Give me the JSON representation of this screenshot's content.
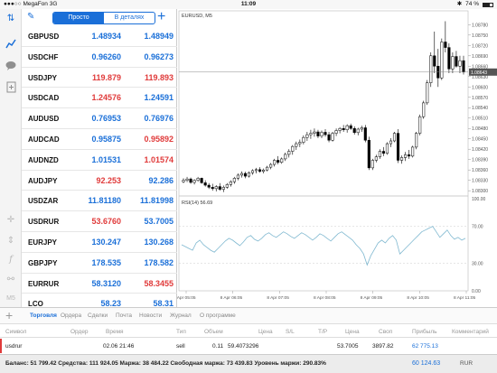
{
  "status": {
    "carrier": "MegaFon",
    "network": "3G",
    "time": "11:09",
    "battery": "74 %",
    "battery_level": 0.74
  },
  "toolbar": {
    "simple_label": "Просто",
    "detailed_label": "В деталях"
  },
  "quotes": [
    {
      "symbol": "GBPUSD",
      "bid": "1.48934",
      "ask": "1.48949",
      "bid_color": "blue",
      "ask_color": "blue"
    },
    {
      "symbol": "USDCHF",
      "bid": "0.96260",
      "ask": "0.96273",
      "bid_color": "blue",
      "ask_color": "blue"
    },
    {
      "symbol": "USDJPY",
      "bid": "119.879",
      "ask": "119.893",
      "bid_color": "red",
      "ask_color": "red"
    },
    {
      "symbol": "USDCAD",
      "bid": "1.24576",
      "ask": "1.24591",
      "bid_color": "red",
      "ask_color": "blue"
    },
    {
      "symbol": "AUDUSD",
      "bid": "0.76953",
      "ask": "0.76976",
      "bid_color": "blue",
      "ask_color": "blue"
    },
    {
      "symbol": "AUDCAD",
      "bid": "0.95875",
      "ask": "0.95892",
      "bid_color": "blue",
      "ask_color": "red"
    },
    {
      "symbol": "AUDNZD",
      "bid": "1.01531",
      "ask": "1.01574",
      "bid_color": "blue",
      "ask_color": "red"
    },
    {
      "symbol": "AUDJPY",
      "bid": "92.253",
      "ask": "92.286",
      "bid_color": "red",
      "ask_color": "blue"
    },
    {
      "symbol": "USDZAR",
      "bid": "11.81180",
      "ask": "11.81998",
      "bid_color": "blue",
      "ask_color": "blue"
    },
    {
      "symbol": "USDRUR",
      "bid": "53.6760",
      "ask": "53.7005",
      "bid_color": "red",
      "ask_color": "blue"
    },
    {
      "symbol": "EURJPY",
      "bid": "130.247",
      "ask": "130.268",
      "bid_color": "blue",
      "ask_color": "blue"
    },
    {
      "symbol": "GBPJPY",
      "bid": "178.535",
      "ask": "178.582",
      "bid_color": "blue",
      "ask_color": "blue"
    },
    {
      "symbol": "EURRUR",
      "bid": "58.3120",
      "ask": "58.3455",
      "bid_color": "blue",
      "ask_color": "red"
    },
    {
      "symbol": "LCO",
      "bid": "58.23",
      "ask": "58.31",
      "bid_color": "blue",
      "ask_color": "blue"
    }
  ],
  "chart": {
    "symbol_label": "EURUSD, M5",
    "rsi_label": "RSI(14) 56.69",
    "price_axis": [
      "1.08780",
      "1.08750",
      "1.08720",
      "1.08690",
      "1.08660",
      "1.08630",
      "1.08600",
      "1.08570",
      "1.08540",
      "1.08510",
      "1.08480",
      "1.08450",
      "1.08420",
      "1.08390",
      "1.08360",
      "1.08330",
      "1.08300"
    ],
    "current_price": "1.08643",
    "rsi_axis": [
      "100.00",
      "70.00",
      "30.00",
      "0.00"
    ],
    "time_axis": [
      "8 Apr 05:05",
      "8 Apr 06:05",
      "8 Apr 07:05",
      "8 Apr 08:05",
      "8 Apr 09:05",
      "8 Apr 10:05",
      "8 Apr 11:05"
    ]
  },
  "chart_data": {
    "type": "candlestick",
    "title": "EURUSD, M5",
    "ylim": [
      1.0829,
      1.0882
    ],
    "current_price": 1.08643,
    "candles": [
      [
        1.08326,
        1.08336,
        1.08322,
        1.0833
      ],
      [
        1.0833,
        1.0834,
        1.08325,
        1.08334
      ],
      [
        1.08334,
        1.08338,
        1.0832,
        1.08324
      ],
      [
        1.08324,
        1.08333,
        1.08318,
        1.0833
      ],
      [
        1.0833,
        1.0834,
        1.08326,
        1.08336
      ],
      [
        1.08336,
        1.08338,
        1.0832,
        1.08323
      ],
      [
        1.08323,
        1.0833,
        1.08312,
        1.08316
      ],
      [
        1.08316,
        1.08322,
        1.08305,
        1.0831
      ],
      [
        1.0831,
        1.0832,
        1.083,
        1.08306
      ],
      [
        1.08306,
        1.08316,
        1.08298,
        1.08312
      ],
      [
        1.08312,
        1.08322,
        1.083,
        1.08304
      ],
      [
        1.08304,
        1.08315,
        1.08296,
        1.0831
      ],
      [
        1.0831,
        1.08322,
        1.08306,
        1.08318
      ],
      [
        1.08318,
        1.0833,
        1.08312,
        1.08326
      ],
      [
        1.08326,
        1.0834,
        1.0832,
        1.08336
      ],
      [
        1.08336,
        1.0835,
        1.0833,
        1.08345
      ],
      [
        1.08345,
        1.08356,
        1.08338,
        1.0835
      ],
      [
        1.0835,
        1.08355,
        1.08336,
        1.08342
      ],
      [
        1.08342,
        1.08356,
        1.08338,
        1.08352
      ],
      [
        1.08352,
        1.08362,
        1.08346,
        1.08358
      ],
      [
        1.08358,
        1.08366,
        1.0835,
        1.08361
      ],
      [
        1.08361,
        1.08368,
        1.08352,
        1.08356
      ],
      [
        1.08356,
        1.08364,
        1.0835,
        1.0836
      ],
      [
        1.0836,
        1.08372,
        1.08356,
        1.08368
      ],
      [
        1.08368,
        1.0838,
        1.08362,
        1.08376
      ],
      [
        1.08376,
        1.08392,
        1.0837,
        1.08388
      ],
      [
        1.08388,
        1.084,
        1.08376,
        1.08382
      ],
      [
        1.08382,
        1.08396,
        1.08378,
        1.08392
      ],
      [
        1.08392,
        1.0841,
        1.08386,
        1.08405
      ],
      [
        1.08405,
        1.0842,
        1.08396,
        1.08414
      ],
      [
        1.08414,
        1.08432,
        1.08404,
        1.08428
      ],
      [
        1.08428,
        1.08442,
        1.08418,
        1.08436
      ],
      [
        1.08436,
        1.08448,
        1.08426,
        1.0844
      ],
      [
        1.0844,
        1.0846,
        1.08434,
        1.08454
      ],
      [
        1.08454,
        1.0847,
        1.08444,
        1.08462
      ],
      [
        1.08462,
        1.08476,
        1.0845,
        1.08466
      ],
      [
        1.08466,
        1.0848,
        1.08456,
        1.0847
      ],
      [
        1.0847,
        1.08476,
        1.08452,
        1.08458
      ],
      [
        1.08458,
        1.08474,
        1.08452,
        1.08469
      ],
      [
        1.08469,
        1.08478,
        1.08456,
        1.08462
      ],
      [
        1.08462,
        1.0847,
        1.0844,
        1.08446
      ],
      [
        1.08446,
        1.0847,
        1.08442,
        1.08466
      ],
      [
        1.08466,
        1.0848,
        1.08458,
        1.08474
      ],
      [
        1.08474,
        1.08484,
        1.08466,
        1.0848
      ],
      [
        1.0848,
        1.0849,
        1.0847,
        1.08476
      ],
      [
        1.08476,
        1.08492,
        1.08468,
        1.08488
      ],
      [
        1.08488,
        1.08494,
        1.08476,
        1.0848
      ],
      [
        1.0848,
        1.08486,
        1.08462,
        1.08468
      ],
      [
        1.08468,
        1.08482,
        1.0846,
        1.08478
      ],
      [
        1.08478,
        1.08488,
        1.0847,
        1.08482
      ],
      [
        1.08482,
        1.0849,
        1.0844,
        1.08446
      ],
      [
        1.08446,
        1.08456,
        1.0836,
        1.08366
      ],
      [
        1.08366,
        1.08392,
        1.0836,
        1.08388
      ],
      [
        1.08388,
        1.08404,
        1.08382,
        1.08398
      ],
      [
        1.08398,
        1.0842,
        1.08392,
        1.08414
      ],
      [
        1.08414,
        1.08426,
        1.084,
        1.08408
      ],
      [
        1.08408,
        1.0844,
        1.08404,
        1.08436
      ],
      [
        1.08436,
        1.08452,
        1.08426,
        1.08444
      ],
      [
        1.08444,
        1.0847,
        1.0844,
        1.08466
      ],
      [
        1.08466,
        1.08478,
        1.0838,
        1.08388
      ],
      [
        1.08388,
        1.08402,
        1.08378,
        1.08396
      ],
      [
        1.08396,
        1.08412,
        1.08386,
        1.08404
      ],
      [
        1.08404,
        1.08418,
        1.08392,
        1.084
      ],
      [
        1.084,
        1.0843,
        1.08396,
        1.08426
      ],
      [
        1.08426,
        1.0847,
        1.0842,
        1.08466
      ],
      [
        1.08466,
        1.0852,
        1.0846,
        1.08514
      ],
      [
        1.08514,
        1.0856,
        1.08508,
        1.08554
      ],
      [
        1.08554,
        1.0862,
        1.08548,
        1.08612
      ],
      [
        1.08612,
        1.087,
        1.086,
        1.0869
      ],
      [
        1.0869,
        1.0876,
        1.0864,
        1.0866
      ],
      [
        1.0866,
        1.0871,
        1.086,
        1.08626
      ],
      [
        1.08626,
        1.0874,
        1.0862,
        1.0873
      ],
      [
        1.0873,
        1.0879,
        1.087,
        1.08714
      ],
      [
        1.08714,
        1.08726,
        1.0864,
        1.08652
      ],
      [
        1.08652,
        1.087,
        1.0864,
        1.08688
      ],
      [
        1.08688,
        1.08704,
        1.08656,
        1.0866
      ],
      [
        1.0866,
        1.0869,
        1.0864,
        1.08676
      ],
      [
        1.08676,
        1.0869,
        1.08636,
        1.08643
      ]
    ],
    "rsi_range": [
      0,
      100
    ],
    "rsi_levels": [
      70,
      30
    ],
    "rsi": [
      50,
      48,
      46,
      44,
      52,
      55,
      50,
      47,
      44,
      42,
      46,
      50,
      54,
      57,
      55,
      52,
      49,
      53,
      58,
      60,
      56,
      54,
      57,
      61,
      63,
      60,
      58,
      61,
      64,
      62,
      59,
      57,
      60,
      63,
      61,
      58,
      55,
      58,
      62,
      60,
      57,
      54,
      58,
      62,
      64,
      61,
      58,
      55,
      50,
      46,
      40,
      28,
      38,
      45,
      52,
      55,
      52,
      57,
      60,
      55,
      40,
      44,
      48,
      52,
      56,
      60,
      64,
      66,
      68,
      70,
      64,
      58,
      62,
      66,
      60,
      56,
      58,
      55,
      57
    ]
  },
  "bottom_tabs": [
    "Торговля",
    "Ордера",
    "Сделки",
    "Почта",
    "Новости",
    "Журнал",
    "О программе"
  ],
  "trade_table": {
    "headers": [
      "Символ",
      "Ордер",
      "Время",
      "Тип",
      "Объем",
      "Цена",
      "S/L",
      "T/P",
      "Цена",
      "Своп",
      "Прибыль",
      "Комментарий"
    ],
    "row": {
      "symbol": "usdrur",
      "time": "02.06 21:46",
      "type": "sell",
      "volume": "0.11",
      "price": "59.4073296",
      "cur_price": "53.7005",
      "swap": "3897.82",
      "profit": "62 775.13"
    }
  },
  "footer": {
    "summary": "Баланс: 51 799.42 Средства: 111 924.05 Маржа: 38 484.22 Свободная маржа: 73 439.83 Уровень маржи: 290.83%",
    "total": "60 124.63",
    "currency": "RUR"
  },
  "colors": {
    "accent": "#1a6fd8",
    "down": "#e03a3a",
    "rsi_line": "#7fb8d0"
  }
}
